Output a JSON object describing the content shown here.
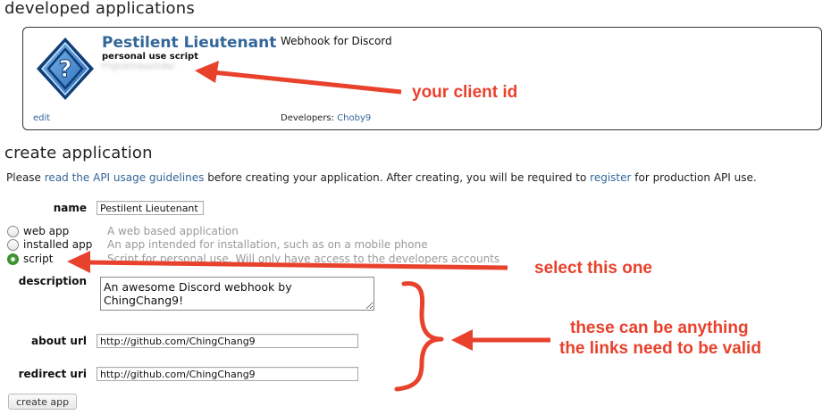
{
  "developed": {
    "heading": "developed applications",
    "app": {
      "name": "Pestilent Lieutenant",
      "type": "personal use script",
      "client_id": "FYgkdUh4sa2tdke",
      "description": "Webhook for Discord",
      "edit": "edit",
      "developers_label": "Developers:",
      "developer": "Choby9"
    }
  },
  "create": {
    "heading": "create application",
    "intro": {
      "pre": "Please ",
      "link_guidelines": "read the API usage guidelines",
      "mid": " before creating your application. After creating, you will be required to ",
      "link_register": "register",
      "post": " for production API use."
    },
    "fields": {
      "name_label": "name",
      "name_value": "Pestilent Lieutenant",
      "description_label": "description",
      "description_value": "An awesome Discord webhook by ChingChang9!",
      "about_label": "about url",
      "about_value": "http://github.com/ChingChang9",
      "redirect_label": "redirect uri",
      "redirect_value": "http://github.com/ChingChang9"
    },
    "types": [
      {
        "label": "web app",
        "help": "A web based application",
        "checked": false
      },
      {
        "label": "installed app",
        "help": "An app intended for installation, such as on a mobile phone",
        "checked": false
      },
      {
        "label": "script",
        "help": "Script for personal use. Will only have access to the developers accounts",
        "checked": true
      }
    ],
    "button": "create app"
  },
  "annotations": {
    "client_id": "your client id",
    "select": "select this one",
    "anything_line1": "these can be anything",
    "anything_line2": "the links need to be valid",
    "color": "#e8412c"
  }
}
